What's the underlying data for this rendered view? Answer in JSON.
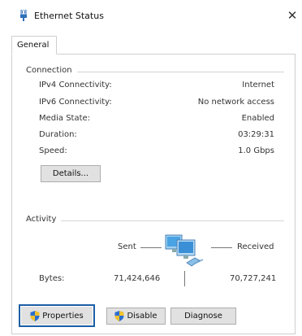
{
  "window": {
    "title": "Ethernet Status",
    "close_label": "✕"
  },
  "tabs": [
    {
      "label": "General"
    }
  ],
  "connection": {
    "group_title": "Connection",
    "rows": [
      {
        "label": "IPv4 Connectivity:",
        "value": "Internet"
      },
      {
        "label": "IPv6 Connectivity:",
        "value": "No network access"
      },
      {
        "label": "Media State:",
        "value": "Enabled"
      },
      {
        "label": "Duration:",
        "value": "03:29:31"
      },
      {
        "label": "Speed:",
        "value": "1.0 Gbps"
      }
    ],
    "details_button": "Details..."
  },
  "activity": {
    "group_title": "Activity",
    "sent_label": "Sent",
    "received_label": "Received",
    "bytes_label": "Bytes:",
    "bytes_sent": "71,424,646",
    "bytes_received": "70,727,241",
    "icon": "network-computers-icon"
  },
  "buttons": {
    "properties": "Properties",
    "disable": "Disable",
    "diagnose": "Diagnose"
  },
  "colors": {
    "focus_border": "#1c5ea6",
    "button_bg": "#e1e1e1",
    "shield_blue": "#2a6fd0",
    "shield_yellow": "#f2c12e"
  }
}
